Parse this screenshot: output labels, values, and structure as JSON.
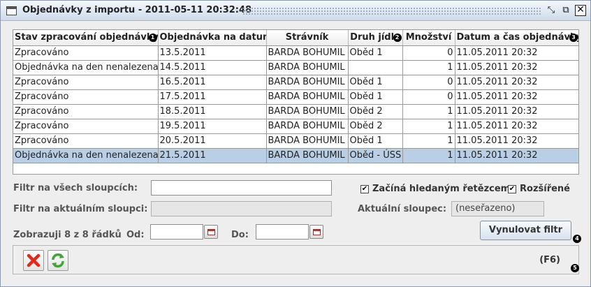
{
  "window": {
    "title": "Objednávky z importu - 2011-05-11 20:32:48",
    "minimize_glyph": "⤡",
    "maximize_glyph": "⧉",
    "close_glyph": "☒"
  },
  "table": {
    "columns": [
      "Stav zpracování objednávky",
      "Objednávka na datum",
      "Strávník",
      "Druh jídla",
      "Množství",
      "Datum a čas objednávky"
    ],
    "rows": [
      [
        "Zpracováno",
        "13.5.2011",
        "BARDA BOHUMIL",
        "Oběd 1",
        "0",
        "11.05.2011 20:32"
      ],
      [
        "Objednávka na den nenalezena",
        "14.5.2011",
        "BARDA BOHUMIL",
        "",
        "1",
        "11.05.2011 20:32"
      ],
      [
        "Zpracováno",
        "16.5.2011",
        "BARDA BOHUMIL",
        "Oběd 1",
        "0",
        "11.05.2011 20:32"
      ],
      [
        "Zpracováno",
        "17.5.2011",
        "BARDA BOHUMIL",
        "Oběd 1",
        "0",
        "11.05.2011 20:32"
      ],
      [
        "Zpracováno",
        "18.5.2011",
        "BARDA BOHUMIL",
        "Oběd 2",
        "1",
        "11.05.2011 20:32"
      ],
      [
        "Zpracováno",
        "19.5.2011",
        "BARDA BOHUMIL",
        "Oběd 2",
        "1",
        "11.05.2011 20:32"
      ],
      [
        "Zpracováno",
        "20.5.2011",
        "BARDA BOHUMIL",
        "Oběd 1",
        "1",
        "11.05.2011 20:32"
      ],
      [
        "Objednávka na den nenalezena",
        "21.5.2011",
        "BARDA BOHUMIL",
        "Oběd - ÚSS",
        "1",
        "11.05.2011 20:32"
      ]
    ],
    "selected_row": 7,
    "badges": [
      "1",
      "2",
      "3"
    ]
  },
  "filters": {
    "all_columns_label": "Filtr na všech sloupcích:",
    "all_columns_value": "",
    "current_column_label": "Filtr na aktuálním sloupci:",
    "current_column_value": "",
    "starts_with_label": "Začíná hledaným řetězcem",
    "starts_with_checked": true,
    "extended_label": "Rozšířené",
    "extended_checked": true,
    "current_column_name_label": "Aktuální sloupec:",
    "current_column_name_value": "(neseřazeno)",
    "check_glyph": "✔"
  },
  "range": {
    "showing_label": "Zobrazuji 8 z 8 řádků",
    "from_label": "Od:",
    "from_value": "",
    "to_label": "Do:",
    "to_value": ""
  },
  "reset_button": {
    "label": "Vynulovat filtr",
    "badge": "4"
  },
  "toolbar": {
    "shortcut": "(F6)",
    "badge": "5",
    "cancel_icon": "close-icon",
    "refresh_icon": "refresh-icon",
    "cancel_color": "#e0281c",
    "refresh_color": "#3fa534"
  }
}
